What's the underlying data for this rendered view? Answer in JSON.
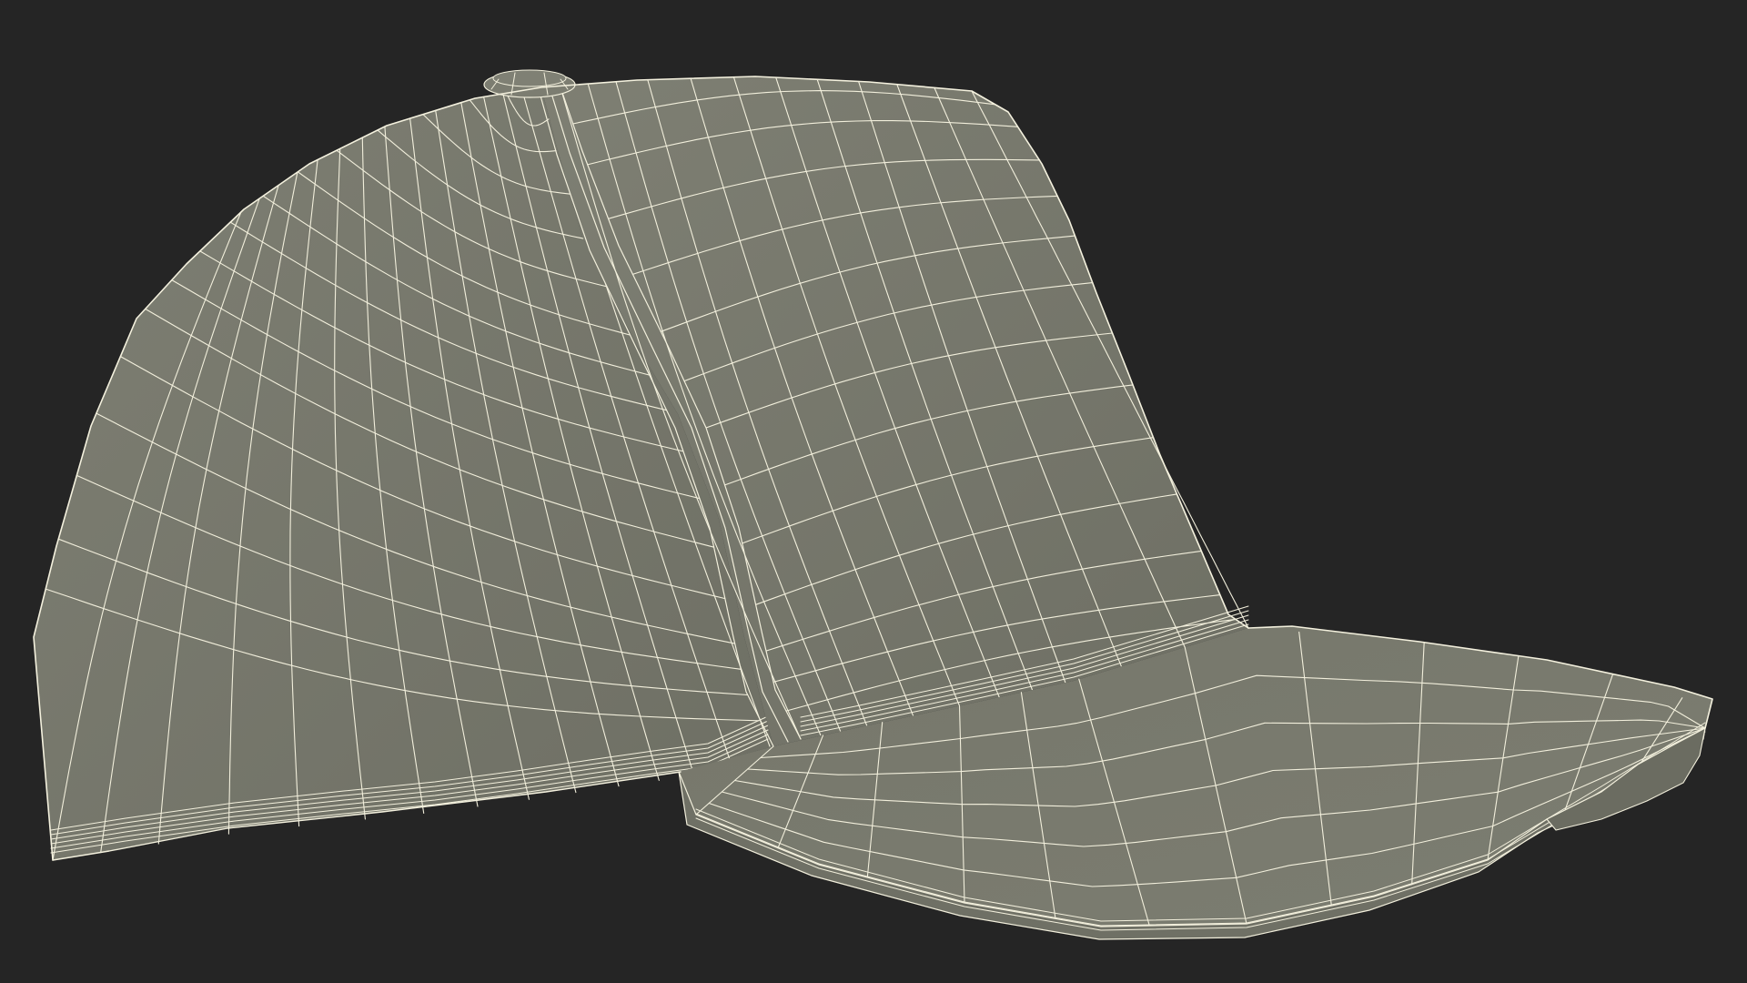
{
  "scene": {
    "subject": "baseball cap",
    "render_style": "wireframe",
    "background_color": "#252525",
    "surface_color": "#7a7b6f",
    "surface_shadow_color": "#6c6d62",
    "wire_color": "#f2efdc",
    "icon_names": [
      "crown-panel",
      "crown-button",
      "visor"
    ]
  }
}
